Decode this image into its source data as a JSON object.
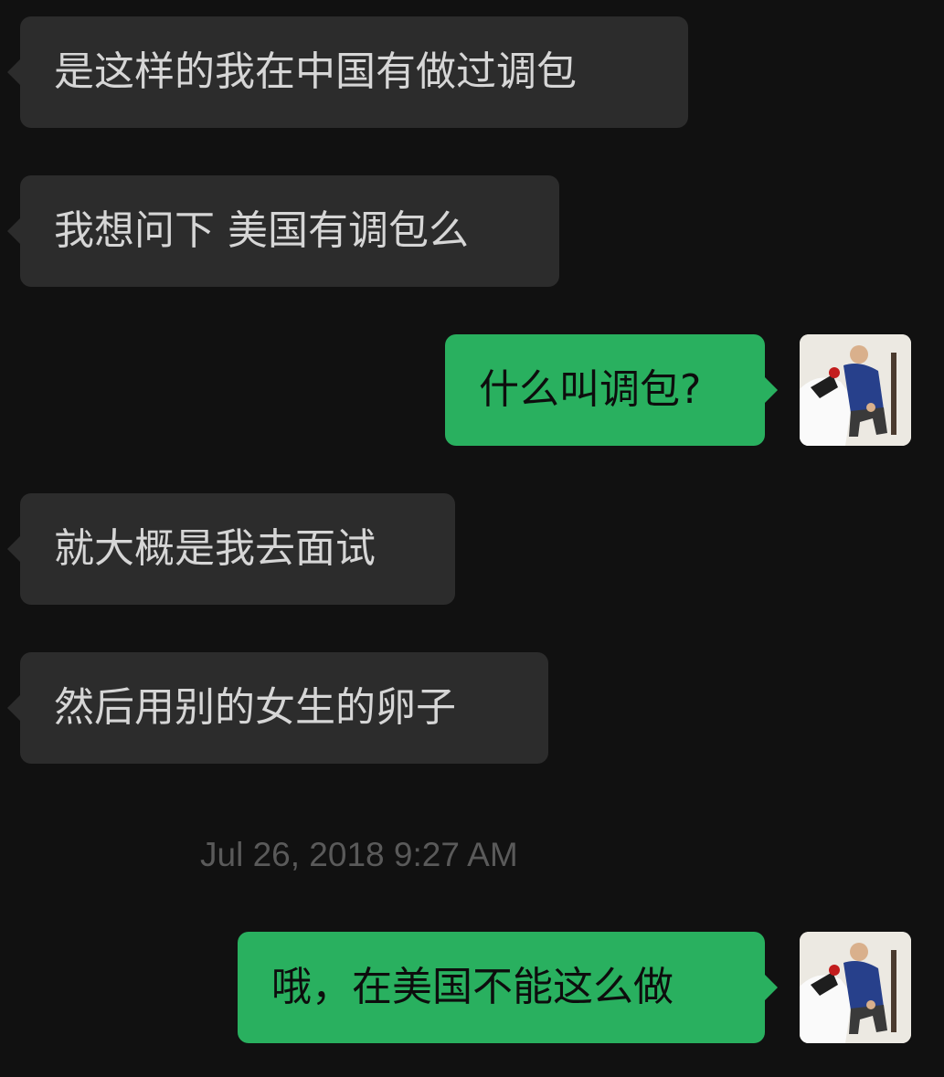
{
  "messages": [
    {
      "direction": "incoming",
      "text": "是这样的我在中国有做过调包"
    },
    {
      "direction": "incoming",
      "text": "我想问下 美国有调包么"
    },
    {
      "direction": "outgoing",
      "text": "什么叫调包?"
    },
    {
      "direction": "incoming",
      "text": "就大概是我去面试"
    },
    {
      "direction": "incoming",
      "text": "然后用别的女生的卵子"
    },
    {
      "direction": "outgoing",
      "text": "哦，在美国不能这么做"
    }
  ],
  "timestamp": "Jul 26, 2018 9:27 AM",
  "colors": {
    "background": "#111111",
    "incoming_bubble": "#2c2c2c",
    "outgoing_bubble": "#29b05f",
    "timestamp_text": "#5a5a5a"
  },
  "icons": {
    "avatar": "user-avatar-photo"
  }
}
